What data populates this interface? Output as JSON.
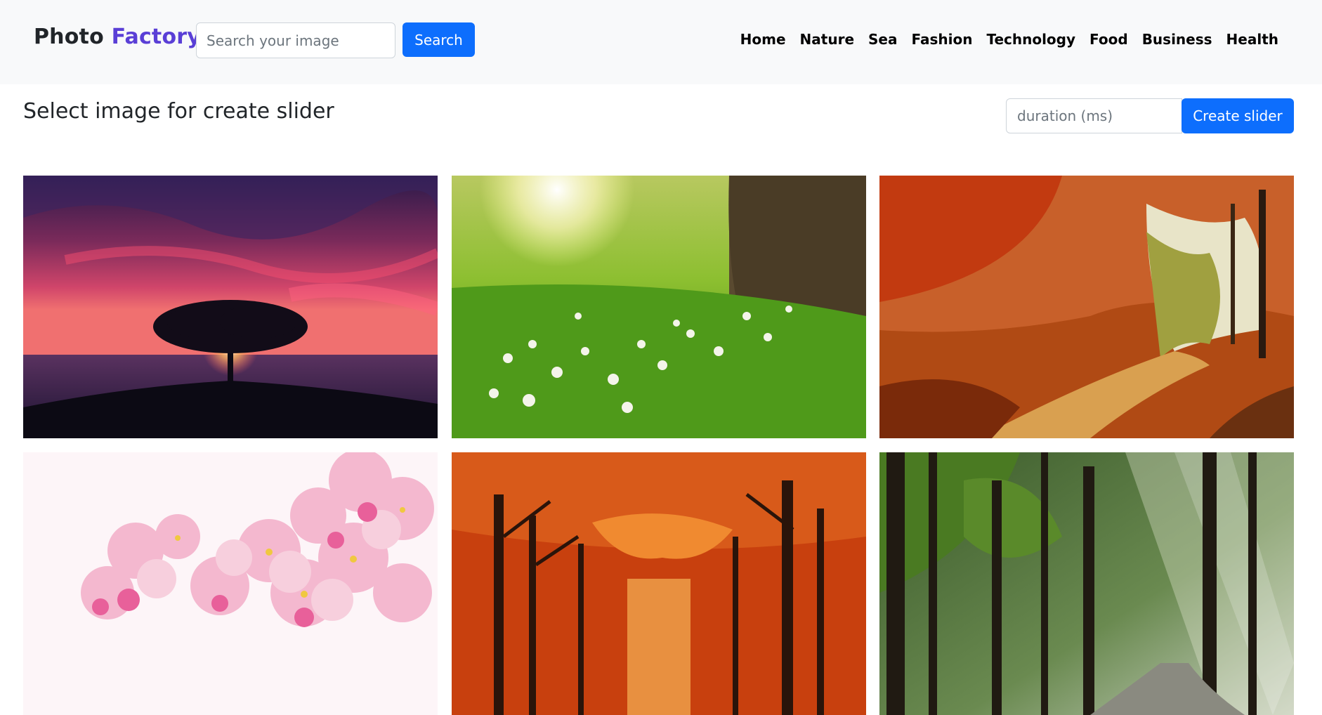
{
  "header": {
    "brand_part1": "Photo ",
    "brand_part2": "Factory",
    "brand_accent_color": "#5a3fd6",
    "search_placeholder": "Search your image",
    "search_button": "Search",
    "nav": [
      "Home",
      "Nature",
      "Sea",
      "Fashion",
      "Technology",
      "Food",
      "Business",
      "Health"
    ]
  },
  "main": {
    "title": "Select image for create slider",
    "duration_placeholder": "duration (ms)",
    "create_button": "Create slider"
  },
  "images": [
    {
      "subject": "tree-sunset"
    },
    {
      "subject": "meadow-flowers"
    },
    {
      "subject": "autumn-path"
    },
    {
      "subject": "cherry-blossoms"
    },
    {
      "subject": "autumn-forest-red"
    },
    {
      "subject": "sunlit-forest"
    }
  ],
  "colors": {
    "primary": "#0d6efd",
    "navbar_bg": "#f8f9fa"
  }
}
